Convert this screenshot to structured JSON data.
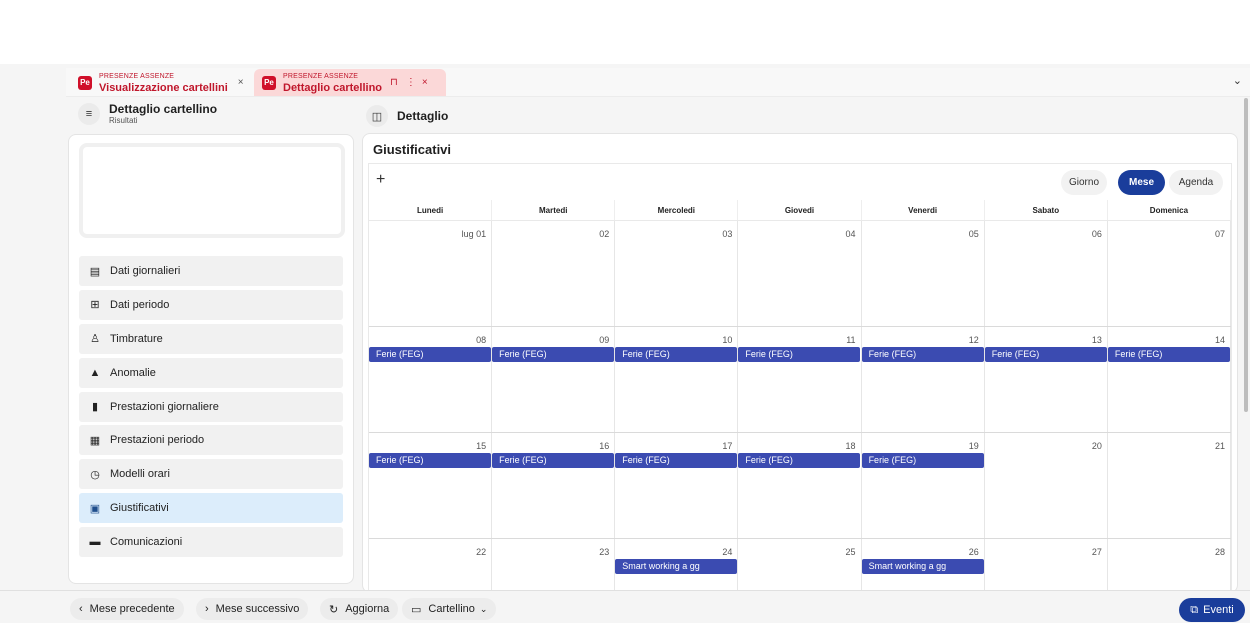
{
  "tabs": [
    {
      "super": "PRESENZE ASSENZE",
      "title": "Visualizzazione cartellini",
      "badge": "Pe",
      "close": "×"
    },
    {
      "super": "PRESENZE ASSENZE",
      "title": "Dettaglio cartellino",
      "badge": "Pe",
      "close": "×",
      "bookmark": "⊓",
      "more": "⋮"
    }
  ],
  "tabbar_chevron": "⌄",
  "left": {
    "title": "Dettaglio cartellino",
    "subtitle": "Risultati",
    "menu": [
      {
        "label": "Dati giornalieri",
        "icon": "calendar-day-icon",
        "glyph": "▤"
      },
      {
        "label": "Dati periodo",
        "icon": "grid-icon",
        "glyph": "⊞"
      },
      {
        "label": "Timbrature",
        "icon": "user-clock-icon",
        "glyph": "♙"
      },
      {
        "label": "Anomalie",
        "icon": "warning-icon",
        "glyph": "▲"
      },
      {
        "label": "Prestazioni giornaliere",
        "icon": "document-icon",
        "glyph": "▮"
      },
      {
        "label": "Prestazioni periodo",
        "icon": "calendar-icon",
        "glyph": "▦"
      },
      {
        "label": "Modelli orari",
        "icon": "calendar-clock-icon",
        "glyph": "◷"
      },
      {
        "label": "Giustificativi",
        "icon": "document-plus-icon",
        "glyph": "▣"
      },
      {
        "label": "Comunicazioni",
        "icon": "message-icon",
        "glyph": "▬"
      }
    ],
    "active_index": 7
  },
  "right": {
    "title": "Dettaglio",
    "section_title": "Giustificativi"
  },
  "calendar": {
    "add": "+",
    "views": [
      "Giorno",
      "Mese",
      "Agenda"
    ],
    "selected_view": "Mese",
    "weekdays": [
      "Lunedi",
      "Martedi",
      "Mercoledi",
      "Giovedi",
      "Venerdi",
      "Sabato",
      "Domenica"
    ],
    "weeks": [
      [
        "lug 01",
        "02",
        "03",
        "04",
        "05",
        "06",
        "07"
      ],
      [
        "08",
        "09",
        "10",
        "11",
        "12",
        "13",
        "14"
      ],
      [
        "15",
        "16",
        "17",
        "18",
        "19",
        "20",
        "21"
      ],
      [
        "22",
        "23",
        "24",
        "25",
        "26",
        "27",
        "28"
      ]
    ],
    "events": [
      {
        "week": 1,
        "day": 0,
        "label": "Ferie (FEG)"
      },
      {
        "week": 1,
        "day": 1,
        "label": "Ferie (FEG)"
      },
      {
        "week": 1,
        "day": 2,
        "label": "Ferie (FEG)"
      },
      {
        "week": 1,
        "day": 3,
        "label": "Ferie (FEG)"
      },
      {
        "week": 1,
        "day": 4,
        "label": "Ferie (FEG)"
      },
      {
        "week": 1,
        "day": 5,
        "label": "Ferie (FEG)"
      },
      {
        "week": 1,
        "day": 6,
        "label": "Ferie (FEG)"
      },
      {
        "week": 2,
        "day": 0,
        "label": "Ferie (FEG)"
      },
      {
        "week": 2,
        "day": 1,
        "label": "Ferie (FEG)"
      },
      {
        "week": 2,
        "day": 2,
        "label": "Ferie (FEG)"
      },
      {
        "week": 2,
        "day": 3,
        "label": "Ferie (FEG)"
      },
      {
        "week": 2,
        "day": 4,
        "label": "Ferie (FEG)"
      },
      {
        "week": 3,
        "day": 2,
        "label": "Smart working a gg"
      },
      {
        "week": 3,
        "day": 4,
        "label": "Smart working a gg"
      }
    ],
    "event_color": "#3b4bb1"
  },
  "bottom": {
    "prev": {
      "label": "Mese precedente",
      "glyph": "‹"
    },
    "next": {
      "label": "Mese successivo",
      "glyph": "›"
    },
    "refresh": {
      "label": "Aggiorna",
      "glyph": "↻"
    },
    "card": {
      "label": "Cartellino",
      "glyph": "▭",
      "chevron": "⌄"
    },
    "events": {
      "label": "Eventi",
      "glyph": "⧉"
    }
  },
  "colors": {
    "accent": "#1a3d9b",
    "brand": "#d0102a",
    "active_menu": "#dcedfb"
  }
}
